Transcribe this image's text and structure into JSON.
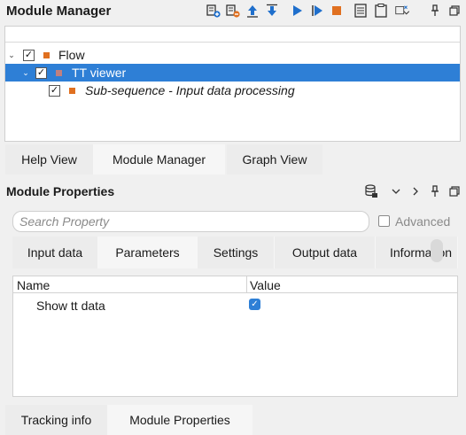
{
  "module_manager": {
    "title": "Module Manager",
    "toolbar_icons": [
      "add-module-icon",
      "remove-module-icon",
      "move-up-icon",
      "move-down-icon",
      "run-icon",
      "step-run-icon",
      "stop-icon",
      "log-icon",
      "clipboard-icon",
      "menu-chevron-icon",
      "pin-icon",
      "restore-icon"
    ],
    "tree": [
      {
        "label": "Flow",
        "checked": true,
        "expanded": true,
        "color": "#e07020"
      },
      {
        "label": "TT viewer",
        "checked": true,
        "expanded": true,
        "color": "#e07020",
        "selected": true
      },
      {
        "label": "Sub-sequence - Input data processing",
        "checked": true,
        "color": "#e07020"
      }
    ],
    "tabs": [
      "Help View",
      "Module Manager",
      "Graph View"
    ],
    "active_tab": "Module Manager"
  },
  "module_properties": {
    "title": "Module Properties",
    "search": {
      "placeholder": "Search Property"
    },
    "advanced_label": "Advanced",
    "tabs": [
      "Input data",
      "Parameters",
      "Settings",
      "Output data",
      "Information"
    ],
    "active_tab": "Parameters",
    "table": {
      "columns": [
        "Name",
        "Value"
      ],
      "rows": [
        {
          "name": "Show tt data",
          "value": true
        }
      ]
    },
    "bottom_tabs": [
      "Tracking info",
      "Module Properties"
    ],
    "active_bottom_tab": "Module Properties"
  },
  "colors": {
    "selection": "#2e7fd6",
    "module_orange": "#e07020",
    "checkbox_blue": "#2e7fd6"
  }
}
